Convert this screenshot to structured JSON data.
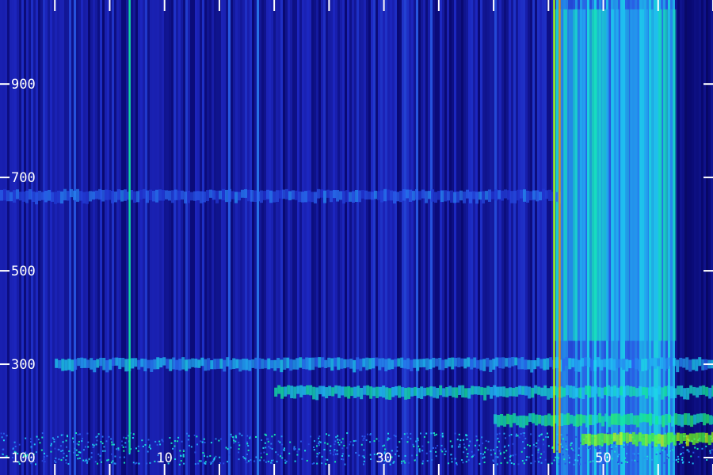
{
  "chart_data": {
    "type": "heatmap",
    "title": "",
    "xlabel": "",
    "ylabel": "",
    "colormap": [
      "#000020",
      "#0a0a78",
      "#1e28c8",
      "#2a64f0",
      "#1ed2f5",
      "#10f08c",
      "#50ff28",
      "#c8ff00",
      "#ff5a00"
    ],
    "y_ticks": [
      {
        "value": 100,
        "label": "100"
      },
      {
        "value": 300,
        "label": "300"
      },
      {
        "value": 500,
        "label": "500"
      },
      {
        "value": 700,
        "label": "700"
      },
      {
        "value": 900,
        "label": "900"
      }
    ],
    "x_ticks": [
      {
        "value": 10,
        "label": "10"
      },
      {
        "value": 30,
        "label": "30"
      },
      {
        "value": 50,
        "label": "50"
      }
    ],
    "x_major_tick_values": [
      0,
      5,
      10,
      15,
      20,
      25,
      30,
      35,
      40,
      45,
      50,
      55,
      60
    ],
    "xlim": [
      -5,
      60
    ],
    "ylim": [
      100,
      1080
    ],
    "bands": [
      {
        "y": 300,
        "intensity": 0.45,
        "x_range": [
          0,
          60
        ]
      },
      {
        "y": 240,
        "intensity": 0.55,
        "x_range": [
          20,
          60
        ]
      },
      {
        "y": 180,
        "intensity": 0.6,
        "x_range": [
          40,
          60
        ]
      },
      {
        "y": 140,
        "intensity": 0.8,
        "x_range": [
          48,
          60
        ]
      },
      {
        "y": 660,
        "intensity": 0.35,
        "x_range": [
          -5,
          46
        ]
      }
    ],
    "vertical_lines": [
      {
        "x": 45.5,
        "intensity": 0.85
      },
      {
        "x": 46.0,
        "intensity": 0.95
      },
      {
        "x": 6.8,
        "intensity": 0.6
      }
    ],
    "high_activity_region": {
      "x_start": 45.5,
      "x_end": 56.5,
      "y_start": 100,
      "y_end": 1080
    }
  }
}
